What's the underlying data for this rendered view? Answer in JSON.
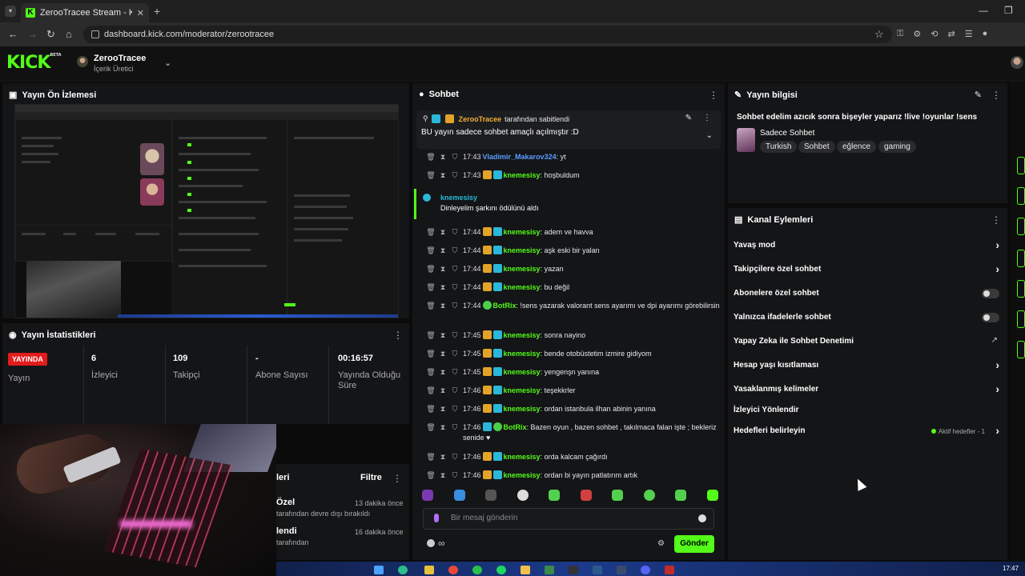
{
  "browser": {
    "tab_title": "ZerooTracee Stream - Kick Da",
    "tab_favicon": "K",
    "new_tab": "+",
    "url": "dashboard.kick.com/moderator/zerootracee"
  },
  "header": {
    "logo": "KICK",
    "logo_badge": "BETA",
    "channel_name": "ZerooTracee",
    "channel_role": "İçerik Üretici"
  },
  "preview": {
    "title": "Yayın Ön İzlemesi"
  },
  "stats": {
    "title": "Yayın İstatistikleri",
    "live_badge": "YAYINDA",
    "items": [
      {
        "value": "",
        "label": "Yayın"
      },
      {
        "value": "6",
        "label": "İzleyici"
      },
      {
        "value": "109",
        "label": "Takipçi"
      },
      {
        "value": "-",
        "label": "Abone Sayısı"
      },
      {
        "value": "00:16:57",
        "label": "Yayında Olduğu Süre"
      }
    ]
  },
  "activity": {
    "title_partial": "leri",
    "filter": "Filtre",
    "items": [
      {
        "title": "Özel",
        "sub": "tarafından devre dışı bırakıldı",
        "time": "13 dakika önce"
      },
      {
        "title": "lendi",
        "sub": "tarafından",
        "time": "16 dakika önce"
      }
    ]
  },
  "chat": {
    "title": "Sohbet",
    "pinned": {
      "by": "ZerooTracee",
      "by_suffix": "tarafından sabitlendi",
      "text": "BU yayın sadece sohbet amaçlı açılmıştır :D"
    },
    "highlight": {
      "user": "knemesisy",
      "text": "Dinleyelim şarkını ödülünü aldı"
    },
    "messages": [
      {
        "time": "17:43",
        "user": "Vladimir_Makarov324",
        "text": "yt",
        "color": "#5b9cff",
        "badges": []
      },
      {
        "time": "17:43",
        "user": "knemesisy",
        "text": "hoşbuldum",
        "color": "#53fc18",
        "badges": [
          "crown",
          "sub"
        ]
      },
      {
        "time": "17:44",
        "user": "knemesisy",
        "text": "adem ve havva",
        "color": "#53fc18",
        "badges": [
          "crown",
          "sub"
        ]
      },
      {
        "time": "17:44",
        "user": "knemesisy",
        "text": "aşk eski bir yalan",
        "color": "#53fc18",
        "badges": [
          "crown",
          "sub"
        ]
      },
      {
        "time": "17:44",
        "user": "knemesisy",
        "text": "yazan",
        "color": "#53fc18",
        "badges": [
          "crown",
          "sub"
        ]
      },
      {
        "time": "17:44",
        "user": "knemesisy",
        "text": "bu değil",
        "color": "#53fc18",
        "badges": [
          "crown",
          "sub"
        ]
      },
      {
        "time": "17:44",
        "user": "BotRix",
        "text": "!sens yazarak valorant sens ayarımı ve dpi ayarımı görebilirsin",
        "color": "#53fc18",
        "badges": [
          "bot"
        ]
      },
      {
        "time": "17:45",
        "user": "knemesisy",
        "text": "sonra nayino",
        "color": "#53fc18",
        "badges": [
          "crown",
          "sub"
        ]
      },
      {
        "time": "17:45",
        "user": "knemesisy",
        "text": "bende otobüstetim izmire gidiyom",
        "color": "#53fc18",
        "badges": [
          "crown",
          "sub"
        ]
      },
      {
        "time": "17:45",
        "user": "knemesisy",
        "text": "yengenşn yanına",
        "color": "#53fc18",
        "badges": [
          "crown",
          "sub"
        ]
      },
      {
        "time": "17:46",
        "user": "knemesisy",
        "text": "teşekkrler",
        "color": "#53fc18",
        "badges": [
          "crown",
          "sub"
        ]
      },
      {
        "time": "17:46",
        "user": "knemesisy",
        "text": "ordan istanbula ilhan abinin yanına",
        "color": "#53fc18",
        "badges": [
          "crown",
          "sub"
        ]
      },
      {
        "time": "17:46",
        "user": "BotRix",
        "text": "Bazen oyun , bazen sohbet , takılmaca falan işte ; bekleriz senide ♥",
        "color": "#53fc18",
        "badges": [
          "sub",
          "bot"
        ]
      },
      {
        "time": "17:46",
        "user": "knemesisy",
        "text": "orda kalcam çağırdı",
        "color": "#53fc18",
        "badges": [
          "crown",
          "sub"
        ]
      },
      {
        "time": "17:46",
        "user": "knemesisy",
        "text": "ordan bi yayın patlatırım artık",
        "color": "#53fc18",
        "badges": [
          "crown",
          "sub"
        ]
      }
    ],
    "input_placeholder": "Bir mesaj gönderin",
    "send": "Gönder",
    "infinity": "∞"
  },
  "stream_info": {
    "title": "Yayın bilgisi",
    "stream_title": "Sohbet edelim azıcık sonra bişeyler yaparız !live !oyunlar !sens",
    "category": "Sadece Sohbet",
    "tags": [
      "Turkish",
      "Sohbet",
      "eğlence",
      "gaming"
    ]
  },
  "channel_actions": {
    "title": "Kanal Eylemleri",
    "items": [
      {
        "label": "Yavaş mod",
        "control": "chevron"
      },
      {
        "label": "Takipçilere özel sohbet",
        "control": "chevron"
      },
      {
        "label": "Abonelere özel sohbet",
        "control": "toggle"
      },
      {
        "label": "Yalnızca ifadelerle sohbet",
        "control": "toggle"
      },
      {
        "label": "Yapay Zeka ile Sohbet Denetimi",
        "control": "external"
      },
      {
        "label": "Hesap yaşı kısıtlaması",
        "control": "chevron"
      },
      {
        "label": "Yasaklanmış kelimeler",
        "control": "chevron"
      },
      {
        "label": "İzleyici Yönlendir",
        "control": "none"
      },
      {
        "label": "Hedefleri belirleyin",
        "control": "chevron",
        "extra": "Aktif hedefler - 1"
      }
    ]
  },
  "taskbar": {
    "clock": "17:47"
  },
  "colors": {
    "brand_green": "#53fc18",
    "live_red": "#e31c1c",
    "panel_bg": "#141517"
  }
}
